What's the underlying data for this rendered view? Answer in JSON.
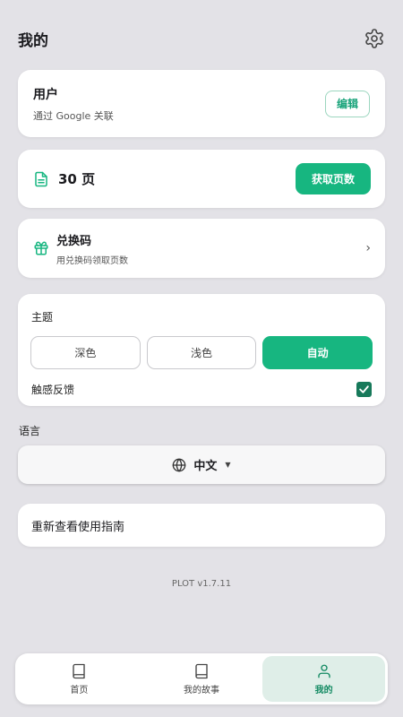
{
  "header": {
    "title": "我的"
  },
  "user": {
    "name": "用户",
    "subtitle": "通过 Google 关联",
    "edit_label": "编辑"
  },
  "pages": {
    "count_label": "30 页",
    "button_label": "获取页数"
  },
  "redeem": {
    "title": "兑换码",
    "subtitle": "用兑换码领取页数"
  },
  "settings": {
    "theme_label": "主题",
    "themes": [
      "深色",
      "浅色",
      "自动"
    ],
    "selected_theme": "自动",
    "haptic_label": "触感反馈",
    "haptic_enabled": true
  },
  "language": {
    "label": "语言",
    "value": "中文"
  },
  "guide": {
    "label": "重新查看使用指南"
  },
  "version": "PLOT v1.7.11",
  "tabs": [
    {
      "label": "首页",
      "icon": "book-icon",
      "active": false
    },
    {
      "label": "我的故事",
      "icon": "book-icon",
      "active": false
    },
    {
      "label": "我的",
      "icon": "user-icon",
      "active": true
    }
  ],
  "colors": {
    "accent": "#17b680",
    "accent_dark": "#138a62",
    "background": "#e3e2e7"
  }
}
